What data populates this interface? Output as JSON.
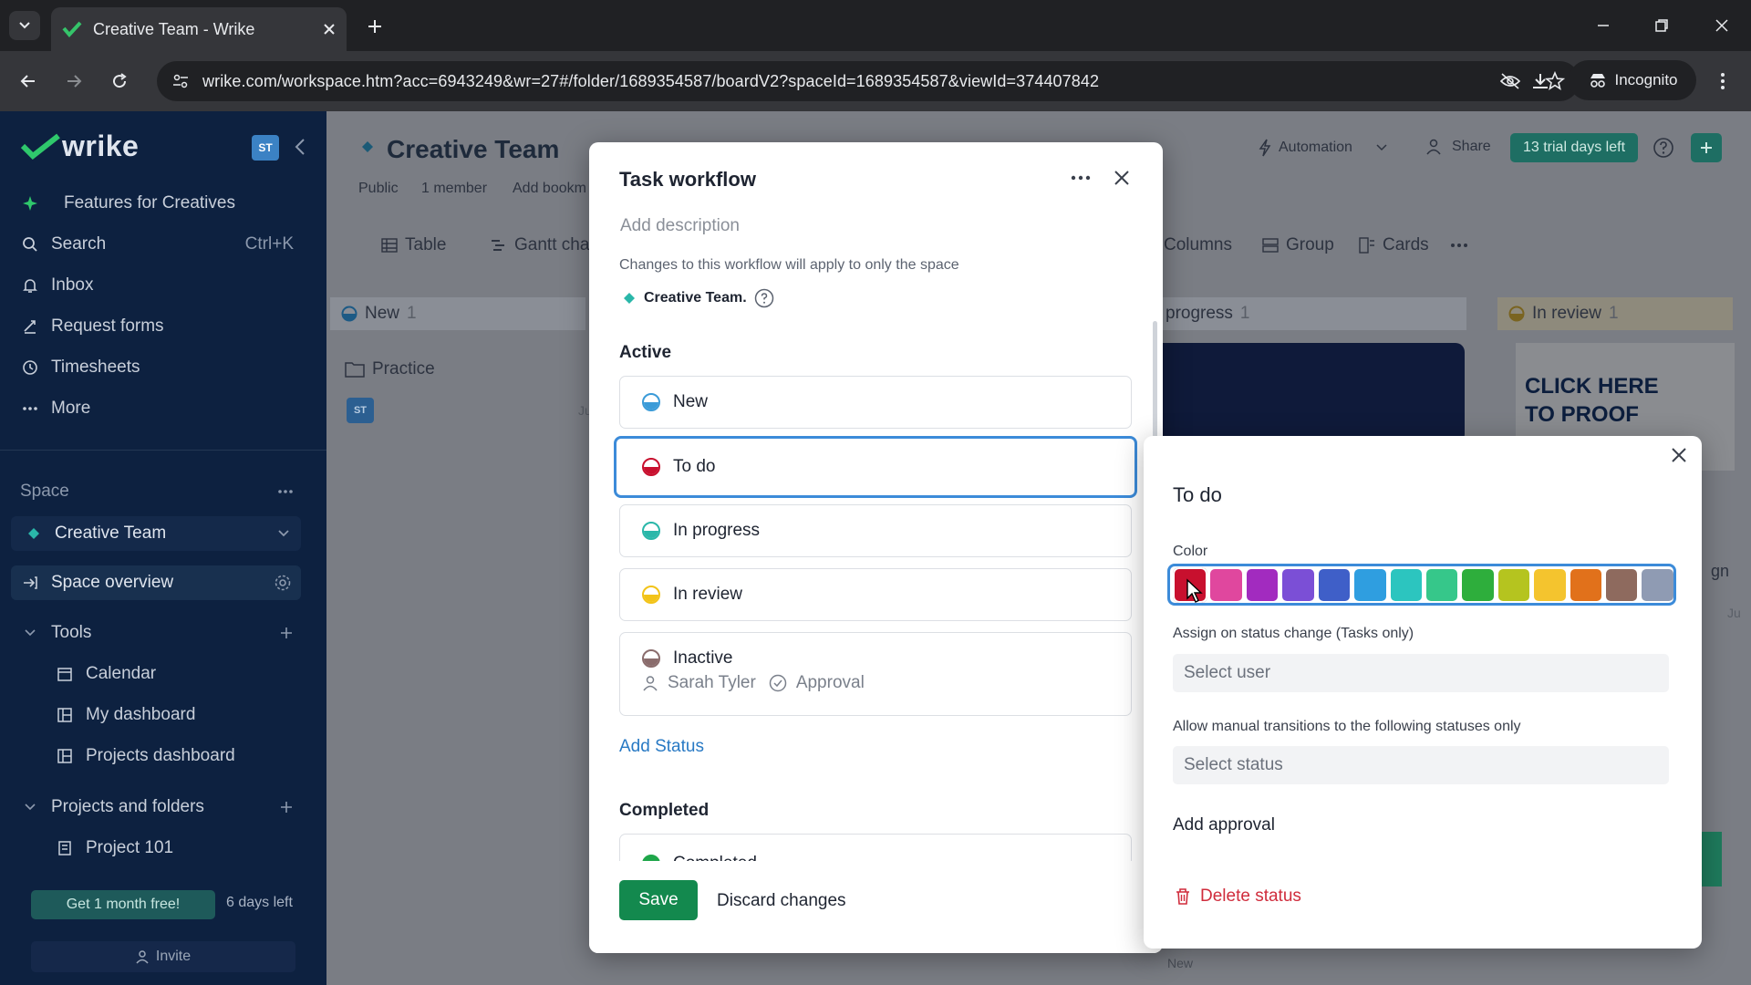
{
  "browser": {
    "tab_title": "Creative Team - Wrike",
    "url": "wrike.com/workspace.htm?acc=6943249&wr=27#/folder/1689354587/boardV2?spaceId=1689354587&viewId=374407842",
    "incognito_label": "Incognito"
  },
  "sidebar": {
    "logo_text": "wrike",
    "avatar": "ST",
    "items": [
      {
        "label": "Features for Creatives",
        "icon": "sparkle-icon"
      },
      {
        "label": "Search",
        "shortcut": "Ctrl+K",
        "icon": "search-icon"
      },
      {
        "label": "Inbox",
        "icon": "bell-icon"
      },
      {
        "label": "Request forms",
        "icon": "form-icon"
      },
      {
        "label": "Timesheets",
        "icon": "clock-icon"
      },
      {
        "label": "More",
        "icon": "more-icon"
      }
    ],
    "space_heading": "Space",
    "space_name": "Creative Team",
    "space_overview": "Space overview",
    "tools_heading": "Tools",
    "tools": [
      "Calendar",
      "My dashboard",
      "Projects dashboard"
    ],
    "projects_heading": "Projects and folders",
    "projects": [
      "Project 101"
    ],
    "get_free": "Get 1 month free!",
    "days_left": "6 days left",
    "invite": "Invite"
  },
  "main": {
    "title": "Creative Team",
    "meta": [
      "Public",
      "1 member",
      "Add bookm"
    ],
    "automation": "Automation",
    "share": "Share",
    "trial": "13 trial days left",
    "views": [
      "Table",
      "Gantt cha"
    ],
    "view_tools": [
      "Columns",
      "Group",
      "Cards"
    ],
    "columns": [
      {
        "name": "New",
        "count": "1"
      },
      {
        "name": "progress",
        "count": "1"
      },
      {
        "name": "In review",
        "count": "1"
      }
    ],
    "card_folder": "Practice",
    "card_avatar": "ST",
    "proof_text_1": "CLICK HERE",
    "proof_text_2": "TO PROOF",
    "frag_1": "gn",
    "frag_2": "Ju",
    "frag_3": "Ju",
    "bottom_new": "New"
  },
  "workflow_modal": {
    "title": "Task workflow",
    "description_placeholder": "Add description",
    "changes_note": "Changes to this workflow will apply to only the space",
    "space_name": "Creative Team.",
    "active_heading": "Active",
    "statuses": [
      {
        "label": "New",
        "color": "#3b9bd8"
      },
      {
        "label": "To do",
        "color": "#c8102e"
      },
      {
        "label": "In progress",
        "color": "#2ab7a9"
      },
      {
        "label": "In review",
        "color": "#f2c318"
      },
      {
        "label": "Inactive",
        "color": "#8a6c6c",
        "assignee": "Sarah Tyler",
        "approval": "Approval"
      }
    ],
    "add_status": "Add Status",
    "completed_heading": "Completed",
    "completed_status": {
      "label": "Completed",
      "color": "#1fa64a"
    },
    "save": "Save",
    "discard": "Discard changes"
  },
  "status_panel": {
    "title": "To do",
    "color_label": "Color",
    "colors": [
      "#c8102e",
      "#e0479e",
      "#a22bbf",
      "#7b4fd6",
      "#3f5fc8",
      "#2f9ee0",
      "#2cc5bf",
      "#36c78a",
      "#2eae3c",
      "#b5c41f",
      "#f4c42e",
      "#e1711b",
      "#8e6a5e",
      "#8f9bb3"
    ],
    "selected_color_index": 0,
    "assign_label": "Assign on status change (Tasks only)",
    "select_user": "Select user",
    "transitions_label": "Allow manual transitions to the following statuses only",
    "select_status": "Select status",
    "add_approval": "Add approval",
    "delete_status": "Delete status"
  }
}
